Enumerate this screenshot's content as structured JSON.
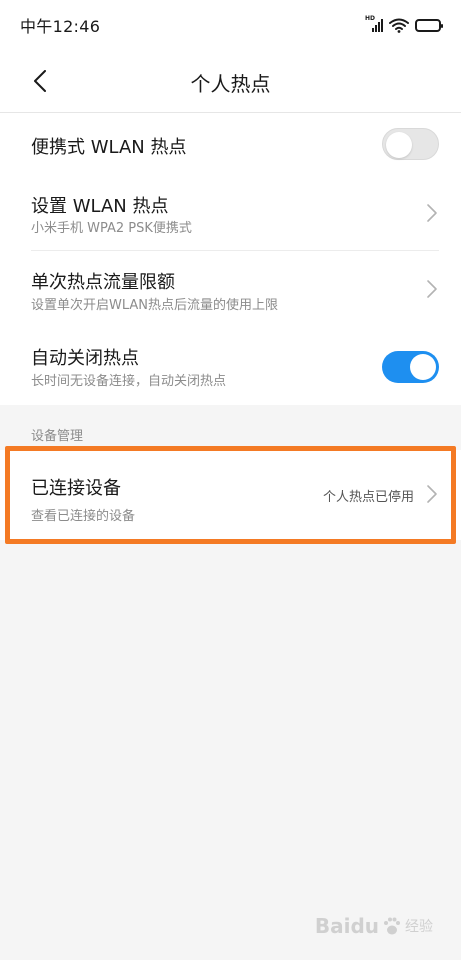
{
  "status_bar": {
    "time": "中午12:46",
    "network_label": "HD",
    "icons": [
      "signal-icon",
      "wifi-icon",
      "battery-icon"
    ]
  },
  "header": {
    "back_icon": "chevron-left-icon",
    "title": "个人热点"
  },
  "settings": {
    "portable_hotspot": {
      "title": "便携式 WLAN 热点",
      "enabled": false
    },
    "setup_hotspot": {
      "title": "设置 WLAN 热点",
      "subtitle": "小米手机 WPA2 PSK便携式"
    },
    "data_limit": {
      "title": "单次热点流量限额",
      "subtitle": "设置单次开启WLAN热点后流量的使用上限"
    },
    "auto_off": {
      "title": "自动关闭热点",
      "subtitle": "长时间无设备连接，自动关闭热点",
      "enabled": true
    }
  },
  "device_section": {
    "label": "设备管理",
    "connected_devices": {
      "title": "已连接设备",
      "subtitle": "查看已连接的设备",
      "status": "个人热点已停用"
    }
  },
  "highlight_color": "#f47a24",
  "toggle_on_color": "#1e8ff0",
  "watermark": {
    "text": "Baidu",
    "sub": "经验"
  }
}
